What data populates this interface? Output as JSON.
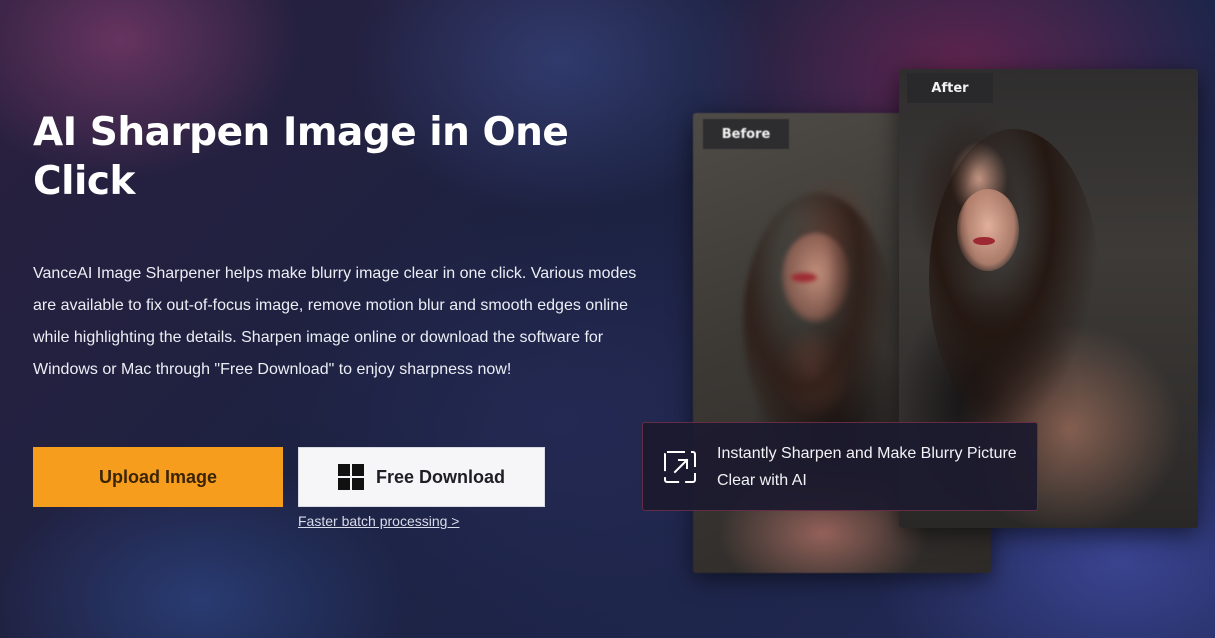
{
  "hero": {
    "title": "AI Sharpen Image in One Click",
    "description": "VanceAI Image Sharpener helps make blurry image clear in one click. Various modes are available to fix out-of-focus image, remove motion blur and smooth edges online while highlighting the details. Sharpen image online or download the software for Windows or Mac through \"Free Download\" to enjoy sharpness now!"
  },
  "actions": {
    "upload_label": "Upload Image",
    "download_label": "Free Download",
    "batch_link": "Faster batch processing >"
  },
  "compare": {
    "before_label": "Before",
    "after_label": "After",
    "caption": "Instantly Sharpen and Make Blurry Picture Clear with AI"
  },
  "colors": {
    "upload_bg": "#f79d1e",
    "download_bg": "#f6f6f8",
    "background": "#1b2036"
  },
  "icons": {
    "download_button": "windows-icon",
    "caption": "expand-icon"
  }
}
